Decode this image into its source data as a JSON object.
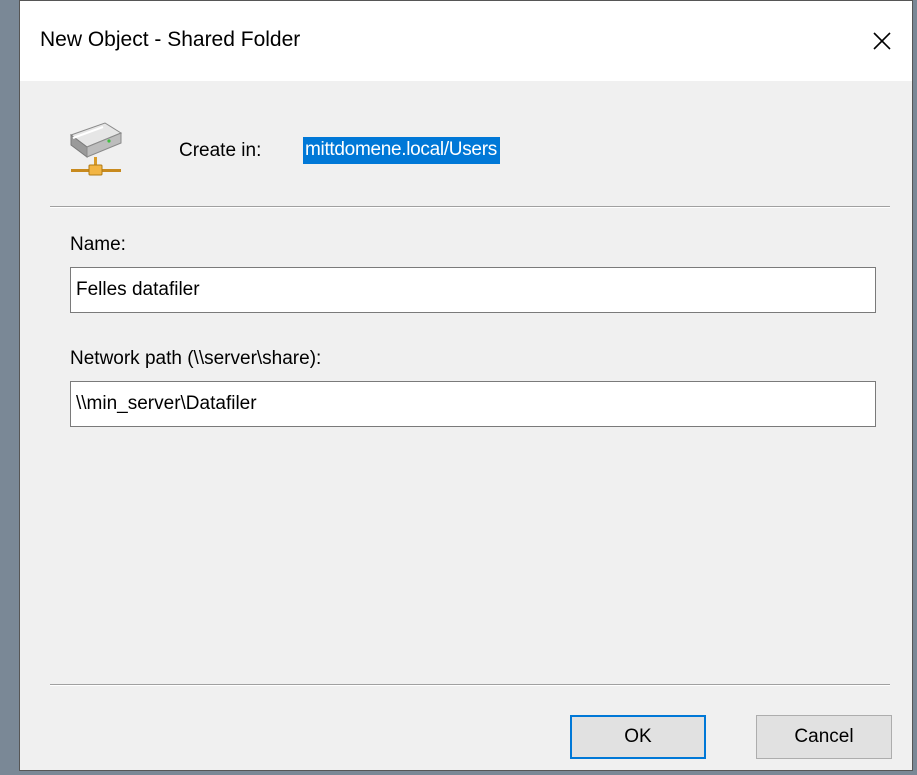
{
  "dialog": {
    "title": "New Object - Shared Folder",
    "close_icon": "close-icon"
  },
  "header": {
    "icon": "network-share-icon",
    "create_in_label": "Create in:",
    "create_in_value": "mittdomene.local/Users",
    "highlight_color": "#0078d7"
  },
  "form": {
    "name_label": "Name:",
    "name_value": "Felles datafiler",
    "path_label": "Network path (\\\\server\\share):",
    "path_value": "\\\\min_server\\Datafiler"
  },
  "buttons": {
    "ok_label": "OK",
    "cancel_label": "Cancel",
    "default_border_color": "#0078d7"
  }
}
